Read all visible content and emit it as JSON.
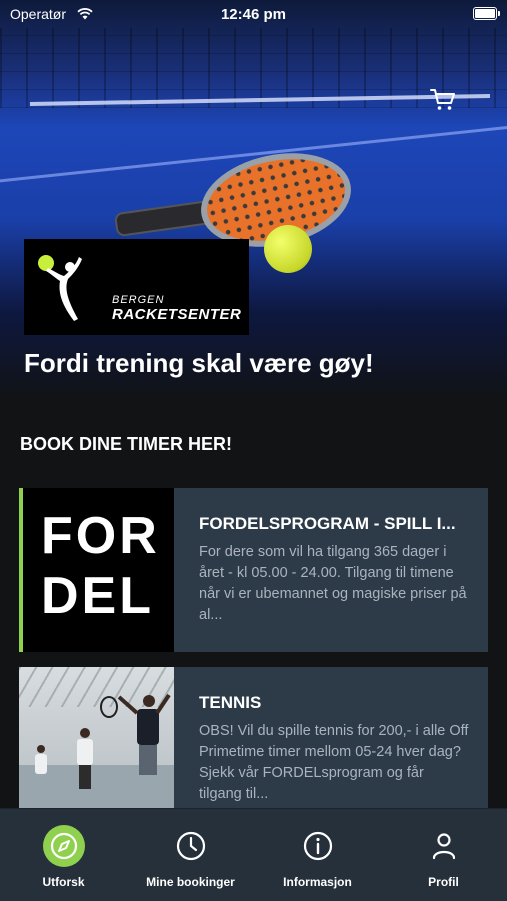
{
  "status_bar": {
    "carrier": "Operatør",
    "time": "12:46 pm"
  },
  "hero": {
    "logo_line1": "BERGEN",
    "logo_line2": "RACKETSENTER",
    "tagline": "Fordi trening skal være gøy!"
  },
  "section_title": "BOOK DINE TIMER HER!",
  "cards": [
    {
      "image_text_top": "FOR",
      "image_text_bottom": "DEL",
      "title": "FORDELSPROGRAM - SPILL I...",
      "description": "For dere som vil ha tilgang 365 dager i året - kl 05.00 - 24.00. Tilgang til timene når vi er ubemannet og magiske priser på al..."
    },
    {
      "title": "TENNIS",
      "description": "OBS! Vil du spille tennis for 200,- i alle Off Primetime timer mellom 05-24 hver dag? Sjekk vår FORDELsprogram og får tilgang til..."
    }
  ],
  "tabs": [
    {
      "label": "Utforsk",
      "icon": "compass-icon",
      "active": true
    },
    {
      "label": "Mine bookinger",
      "icon": "clock-icon",
      "active": false
    },
    {
      "label": "Informasjon",
      "icon": "info-icon",
      "active": false
    },
    {
      "label": "Profil",
      "icon": "person-icon",
      "active": false
    }
  ],
  "colors": {
    "accent": "#8fd14f",
    "card_bg": "#2d3a47",
    "tabbar_bg": "#26303b",
    "background": "#111315"
  }
}
